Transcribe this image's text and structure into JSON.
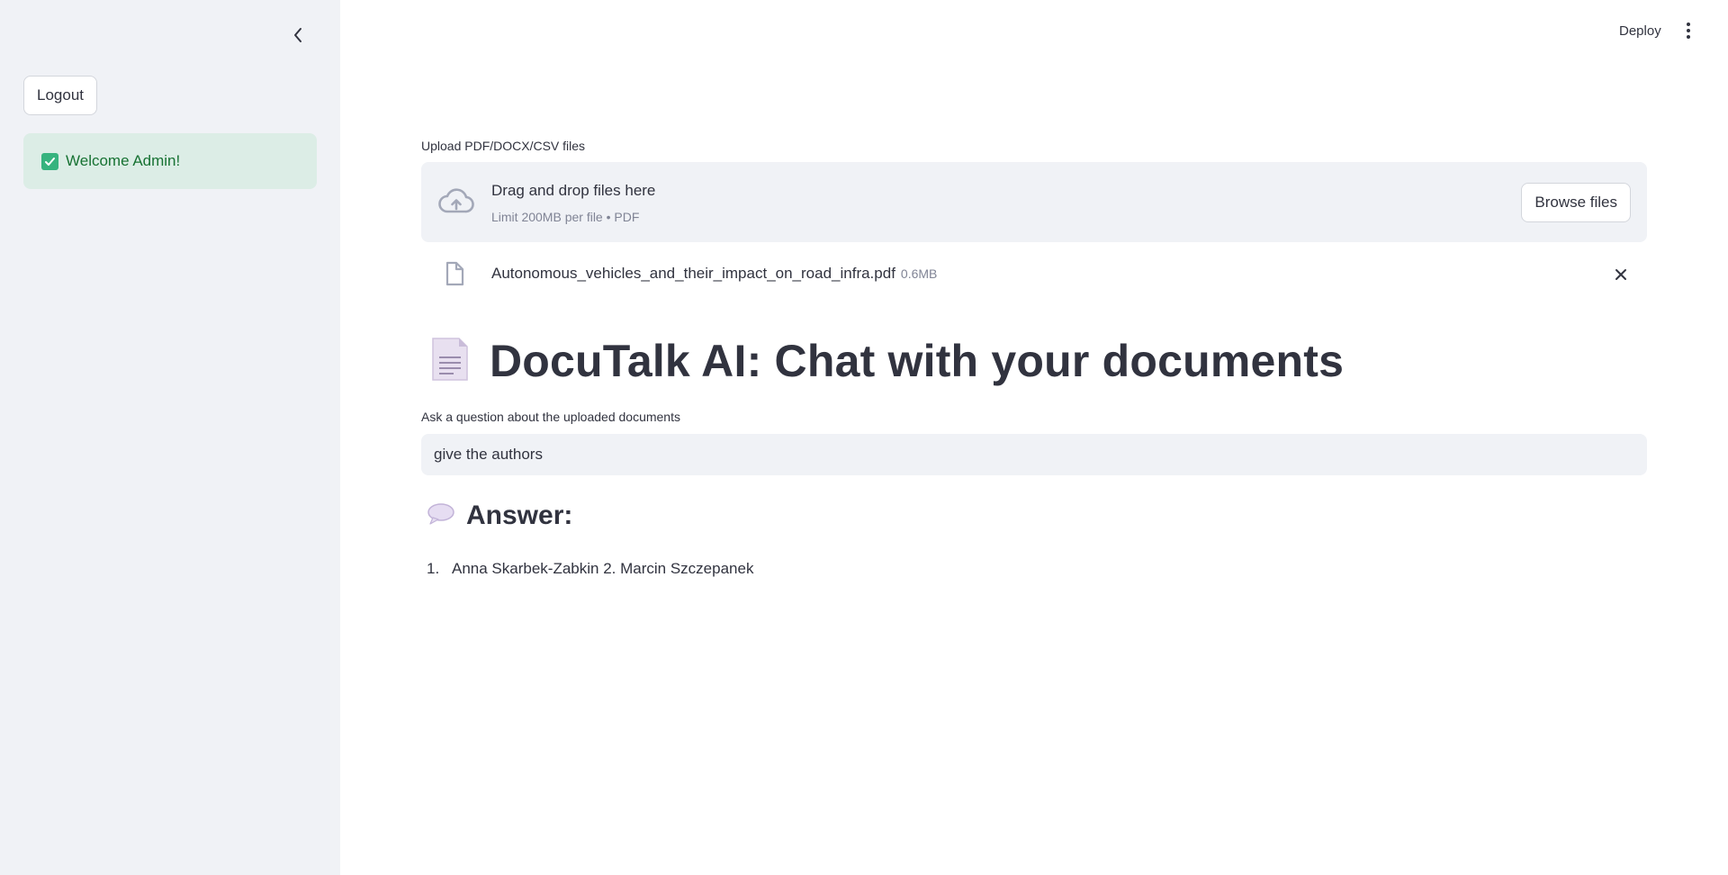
{
  "sidebar": {
    "logout_label": "Logout",
    "welcome_text": "Welcome Admin!"
  },
  "header": {
    "deploy_label": "Deploy"
  },
  "uploader": {
    "label": "Upload PDF/DOCX/CSV files",
    "drop_title": "Drag and drop files here",
    "limit_text": "Limit 200MB per file • PDF",
    "browse_label": "Browse files",
    "file": {
      "name": "Autonomous_vehicles_and_their_impact_on_road_infra.pdf",
      "size": "0.6MB"
    }
  },
  "main": {
    "title": "DocuTalk AI: Chat with your documents",
    "question_label": "Ask a question about the uploaded documents",
    "question_value": "give the authors",
    "answer_heading": "Answer:",
    "answer_items": [
      {
        "num": "1.",
        "text": "Anna Skarbek-Zabkin 2. Marcin Szczepanek"
      }
    ]
  },
  "colors": {
    "sidebar_bg": "#f0f2f6",
    "success_bg": "#dcede6",
    "success_text": "#177233",
    "text": "#31333f",
    "muted": "#808495"
  }
}
